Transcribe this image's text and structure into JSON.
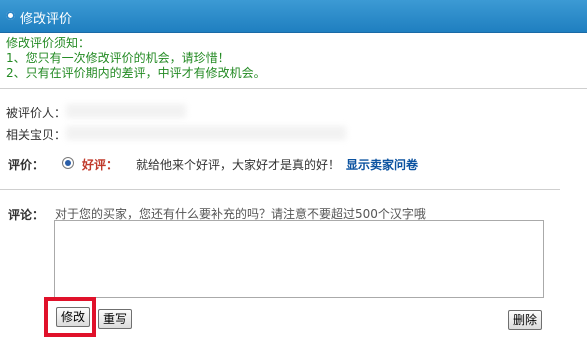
{
  "header": {
    "title": "修改评价"
  },
  "notice": {
    "heading": "修改评价须知：",
    "line1": "1、您只有一次修改评价的机会，请珍惜！",
    "line2": "2、只有在评价期内的差评，中评才有修改机会。"
  },
  "info": {
    "reviewee_label": "被评价人：",
    "item_label": "相关宝贝："
  },
  "rating": {
    "label": "评价：",
    "selected": "好评：",
    "message": "就给他来个好评，大家好才是真的好！",
    "show_qa_link": "显示卖家问卷"
  },
  "comment": {
    "label": "评论：",
    "hint": "对于您的买家，您还有什么要补充的吗？请注意不要超过500个汉字哦",
    "value": ""
  },
  "buttons": {
    "modify": "修改",
    "reset": "重写",
    "delete": "删除"
  },
  "colors": {
    "header": "#2a86c8",
    "notice_text": "#238a23",
    "highlight": "#e0112a",
    "good_rating": "#c0392b",
    "link": "#0b52a0"
  }
}
